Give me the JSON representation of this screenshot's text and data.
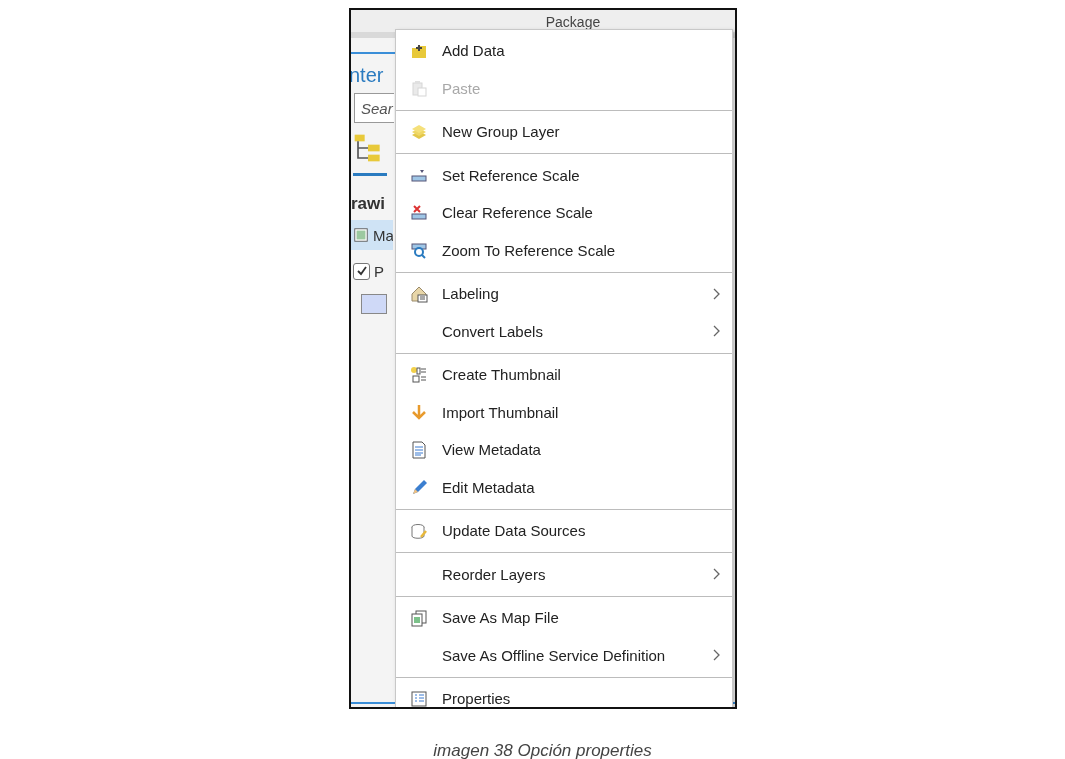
{
  "background_panel": {
    "header": "Package",
    "title_fragment": "nter",
    "search": {
      "placeholder": "Sear"
    },
    "section_fragment": "rawi",
    "map_row": {
      "label": "Ma",
      "selected": true
    },
    "layer_row": {
      "label": "P",
      "checked": true
    }
  },
  "context_menu": {
    "sections": [
      [
        {
          "label": "Add Data",
          "disabled": false,
          "submenu": false
        },
        {
          "label": "Paste",
          "disabled": true,
          "submenu": false
        }
      ],
      [
        {
          "label": "New Group Layer",
          "disabled": false,
          "submenu": false
        }
      ],
      [
        {
          "label": "Set Reference Scale",
          "disabled": false,
          "submenu": false
        },
        {
          "label": "Clear Reference Scale",
          "disabled": false,
          "submenu": false
        },
        {
          "label": "Zoom To Reference Scale",
          "disabled": false,
          "submenu": false
        }
      ],
      [
        {
          "label": "Labeling",
          "disabled": false,
          "submenu": true
        },
        {
          "label": "Convert Labels",
          "disabled": false,
          "submenu": true
        }
      ],
      [
        {
          "label": "Create Thumbnail",
          "disabled": false,
          "submenu": false
        },
        {
          "label": "Import Thumbnail",
          "disabled": false,
          "submenu": false
        },
        {
          "label": "View Metadata",
          "disabled": false,
          "submenu": false
        },
        {
          "label": "Edit Metadata",
          "disabled": false,
          "submenu": false
        }
      ],
      [
        {
          "label": "Update Data Sources",
          "disabled": false,
          "submenu": false
        }
      ],
      [
        {
          "label": "Reorder Layers",
          "disabled": false,
          "submenu": true
        }
      ],
      [
        {
          "label": "Save As Map File",
          "disabled": false,
          "submenu": false
        },
        {
          "label": "Save As Offline Service Definition",
          "disabled": false,
          "submenu": true
        }
      ],
      [
        {
          "label": "Properties",
          "disabled": false,
          "submenu": false
        }
      ]
    ]
  },
  "caption": "imagen 38 Opción properties"
}
